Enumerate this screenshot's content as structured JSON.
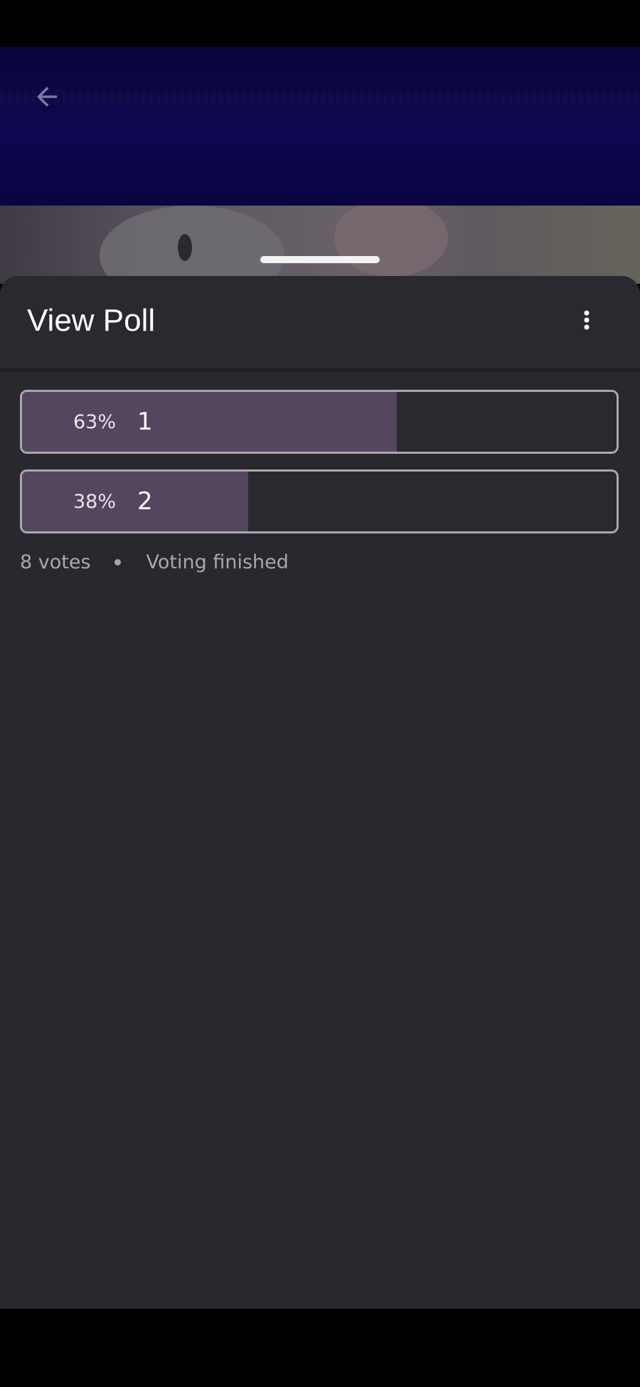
{
  "app_bar": {
    "back_icon": "arrow-left-icon"
  },
  "sheet": {
    "title": "View Poll",
    "more_icon": "more-vertical-icon"
  },
  "poll": {
    "options": [
      {
        "percent_label": "63%",
        "label": "1",
        "fill_percent": 63
      },
      {
        "percent_label": "38%",
        "label": "2",
        "fill_percent": 38
      }
    ],
    "votes_text": "8 votes",
    "status_text": "Voting finished"
  },
  "colors": {
    "sheet_background": "#29282f",
    "option_fill": "#54465f",
    "option_border": "#a8a7ab",
    "app_bar": "#0e0752"
  }
}
